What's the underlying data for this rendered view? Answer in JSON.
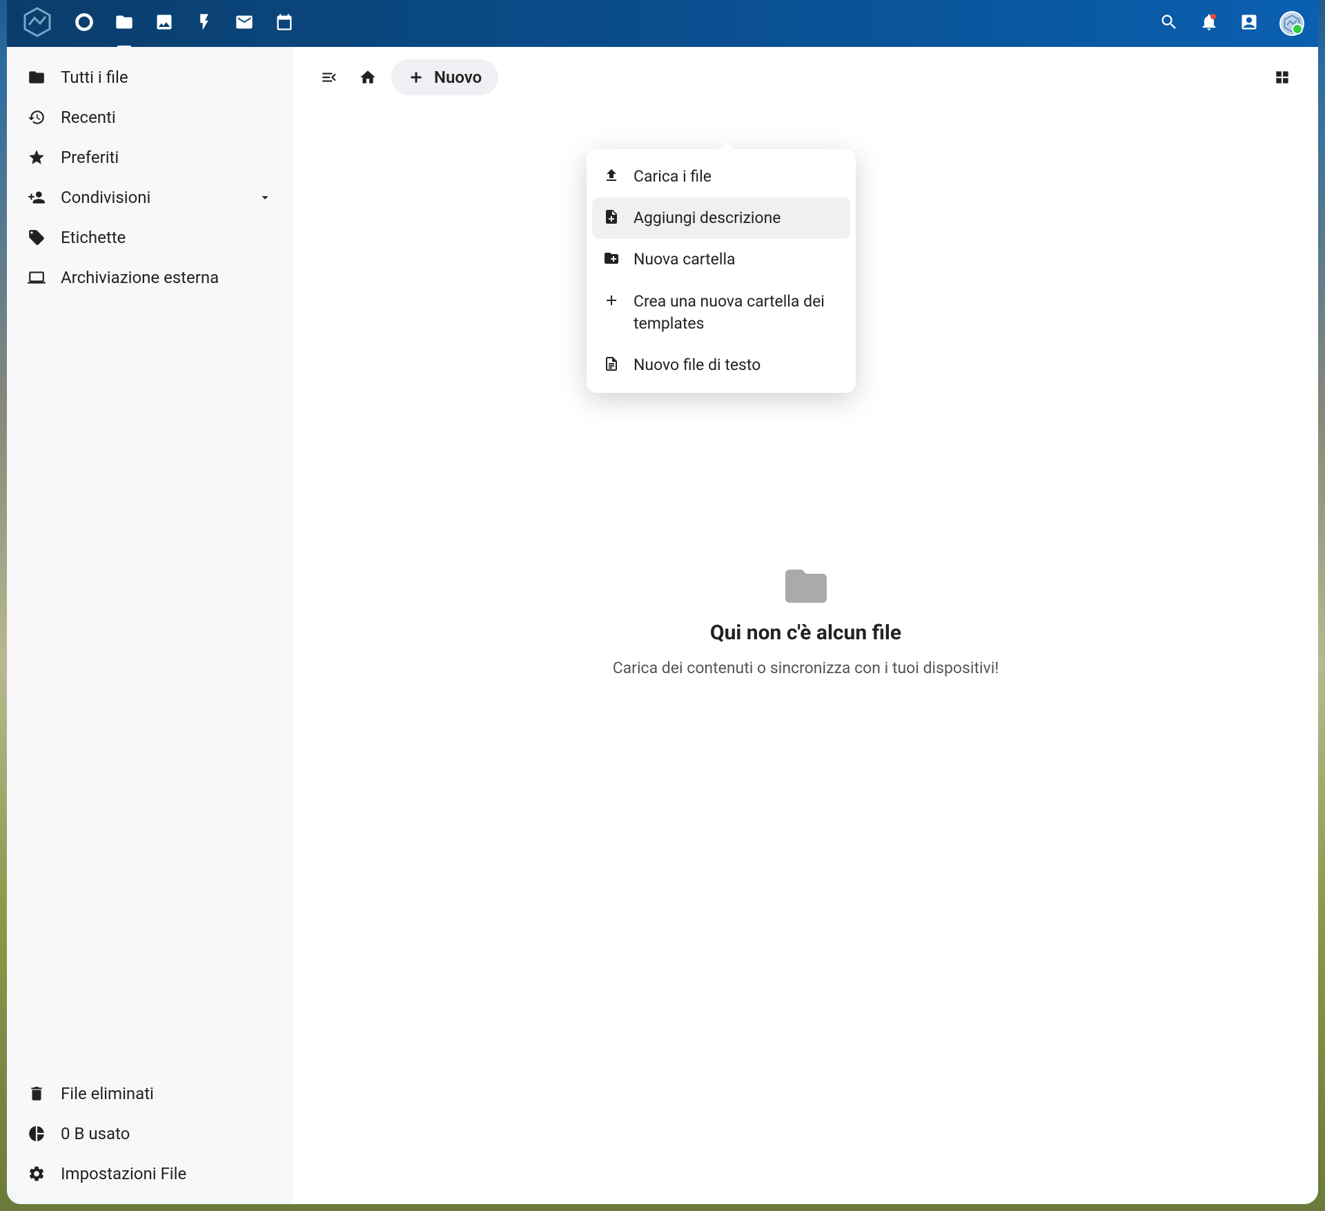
{
  "sidebar": {
    "items": [
      {
        "label": "Tutti i file"
      },
      {
        "label": "Recenti"
      },
      {
        "label": "Preferiti"
      },
      {
        "label": "Condivisioni"
      },
      {
        "label": "Etichette"
      },
      {
        "label": "Archiviazione esterna"
      }
    ],
    "bottom": [
      {
        "label": "File eliminati"
      },
      {
        "label": "0 B usato"
      },
      {
        "label": "Impostazioni File"
      }
    ]
  },
  "toolbar": {
    "new_label": "Nuovo"
  },
  "dropdown": {
    "items": [
      {
        "label": "Carica i file"
      },
      {
        "label": "Aggiungi descrizione"
      },
      {
        "label": "Nuova cartella"
      },
      {
        "label": "Crea una nuova cartella dei templates"
      },
      {
        "label": "Nuovo file di testo"
      }
    ]
  },
  "empty": {
    "title": "Qui non c'è alcun file",
    "subtitle": "Carica dei contenuti o sincronizza con i tuoi dispositivi!"
  }
}
